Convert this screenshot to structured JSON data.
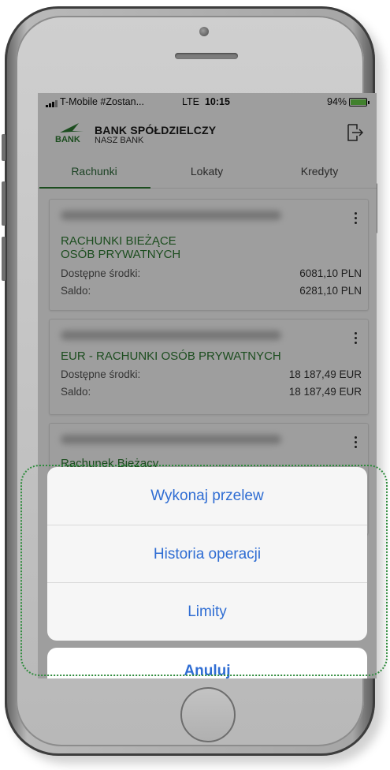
{
  "status_bar": {
    "carrier": "T-Mobile #Zostan...",
    "network": "LTE",
    "time": "10:15",
    "battery": "94%",
    "battery_level": 0.94
  },
  "header": {
    "logo_text": "NASZ BANK",
    "bank_name": "BANK SPÓŁDZIELCZY",
    "bank_subtitle": "NASZ BANK"
  },
  "tabs": [
    {
      "label": "Rachunki",
      "active": true
    },
    {
      "label": "Lokaty",
      "active": false
    },
    {
      "label": "Kredyty",
      "active": false
    }
  ],
  "accounts": [
    {
      "title_line1": "RACHUNKI BIEŻĄCE",
      "title_line2": "OSÓB PRYWATNYCH",
      "available_label": "Dostępne środki:",
      "available_value": "6081,10 PLN",
      "balance_label": "Saldo:",
      "balance_value": "6281,10 PLN"
    },
    {
      "title_line1": "EUR - RACHUNKI OSÓB PRYWATNYCH",
      "available_label": "Dostępne środki:",
      "available_value": "18 187,49 EUR",
      "balance_label": "Saldo:",
      "balance_value": "18 187,49 EUR"
    },
    {
      "title_line1": "Rachunek Bieżący"
    }
  ],
  "action_sheet": {
    "items": [
      "Wykonaj przelew",
      "Historia operacji",
      "Limity"
    ],
    "cancel": "Anuluj"
  },
  "colors": {
    "brand_green": "#2e7d32",
    "ios_blue": "#2f6dd3",
    "highlight": "#2e8b3c"
  }
}
